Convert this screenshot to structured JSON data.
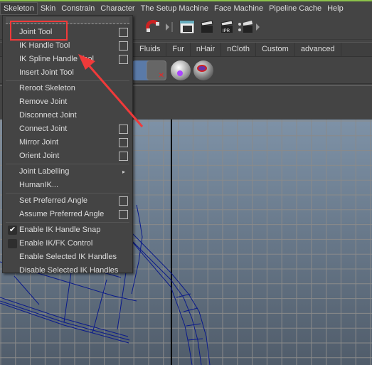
{
  "menubar": {
    "items": [
      "Skeleton",
      "Skin",
      "Constrain",
      "Character",
      "The Setup Machine",
      "Face Machine",
      "Pipeline Cache",
      "Help"
    ],
    "active": "Skeleton"
  },
  "shelf_tabs": [
    "Fluids",
    "Fur",
    "nHair",
    "nCloth",
    "Custom",
    "advanced"
  ],
  "skeleton_menu": {
    "items": [
      {
        "label": "Joint Tool",
        "option_box": true
      },
      {
        "label": "IK Handle Tool",
        "option_box": true
      },
      {
        "label": "IK Spline Handle Tool",
        "option_box": true
      },
      {
        "label": "Insert Joint Tool"
      },
      {
        "label": "Reroot Skeleton"
      },
      {
        "label": "Remove Joint"
      },
      {
        "label": "Disconnect Joint"
      },
      {
        "label": "Connect Joint",
        "option_box": true
      },
      {
        "label": "Mirror Joint",
        "option_box": true
      },
      {
        "label": "Orient Joint",
        "option_box": true
      },
      {
        "label": "Joint Labelling",
        "submenu": true
      },
      {
        "label": "HumanIK..."
      },
      {
        "label": "Set Preferred Angle",
        "option_box": true
      },
      {
        "label": "Assume Preferred Angle",
        "option_box": true
      },
      {
        "label": "Enable IK Handle Snap",
        "checked": true
      },
      {
        "label": "Enable IK/FK Control",
        "checked": false
      },
      {
        "label": "Enable Selected IK Handles"
      },
      {
        "label": "Disable Selected IK Handles"
      }
    ]
  },
  "annotation": {
    "highlight": "Joint Tool",
    "color": "#f03a3a"
  },
  "colors": {
    "accent": "#8cc24a",
    "wireframe": "#0a1a8a"
  }
}
